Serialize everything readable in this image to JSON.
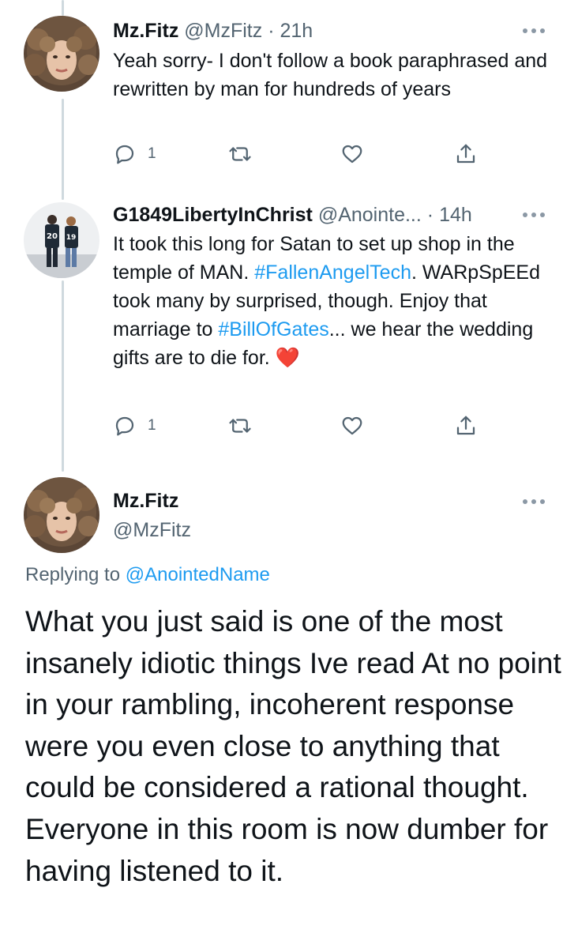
{
  "tweets": [
    {
      "name": "Mz.Fitz",
      "handle": "@MzFitz",
      "separator": "·",
      "time": "21h",
      "text": "Yeah sorry- I don't follow a book paraphrased and rewritten by man for hundreds of years",
      "reply_count": "1",
      "avatar": "curly-hair-woman-avatar"
    },
    {
      "name": "G1849LibertyInChrist",
      "handle": "@Anointe...",
      "separator": "·",
      "time": "14h",
      "text_parts": {
        "p1": "It took this long for Satan to set up shop in the temple of MAN. ",
        "tag1": "#FallenAngelTech",
        "p2": ". WARpSpEEd took many by surprised, though. Enjoy that marriage to ",
        "tag2": "#BillOfGates",
        "p3": "... we hear the wedding gifts are to die for. ",
        "emoji": "❤️"
      },
      "reply_count": "1",
      "avatar": "couple-jerseys-avatar",
      "jersey_numbers": [
        "20",
        "19"
      ]
    }
  ],
  "main_tweet": {
    "name": "Mz.Fitz",
    "handle": "@MzFitz",
    "replying_prefix": "Replying to ",
    "replying_to": "@AnointedName",
    "text": "What you just said is one of the most insanely idiotic things Ive read At no point in your rambling, incoherent response were you even close to anything that could be considered a rational thought. Everyone in this room is now dumber for having listened to it."
  },
  "colors": {
    "link": "#1d9bf0",
    "secondary_text": "#536471",
    "thread_line": "#cfd9de",
    "icon": "#536471",
    "heart_emoji": "#e0245e"
  },
  "icons": [
    "reply-icon",
    "retweet-icon",
    "like-icon",
    "share-icon",
    "more-icon"
  ]
}
